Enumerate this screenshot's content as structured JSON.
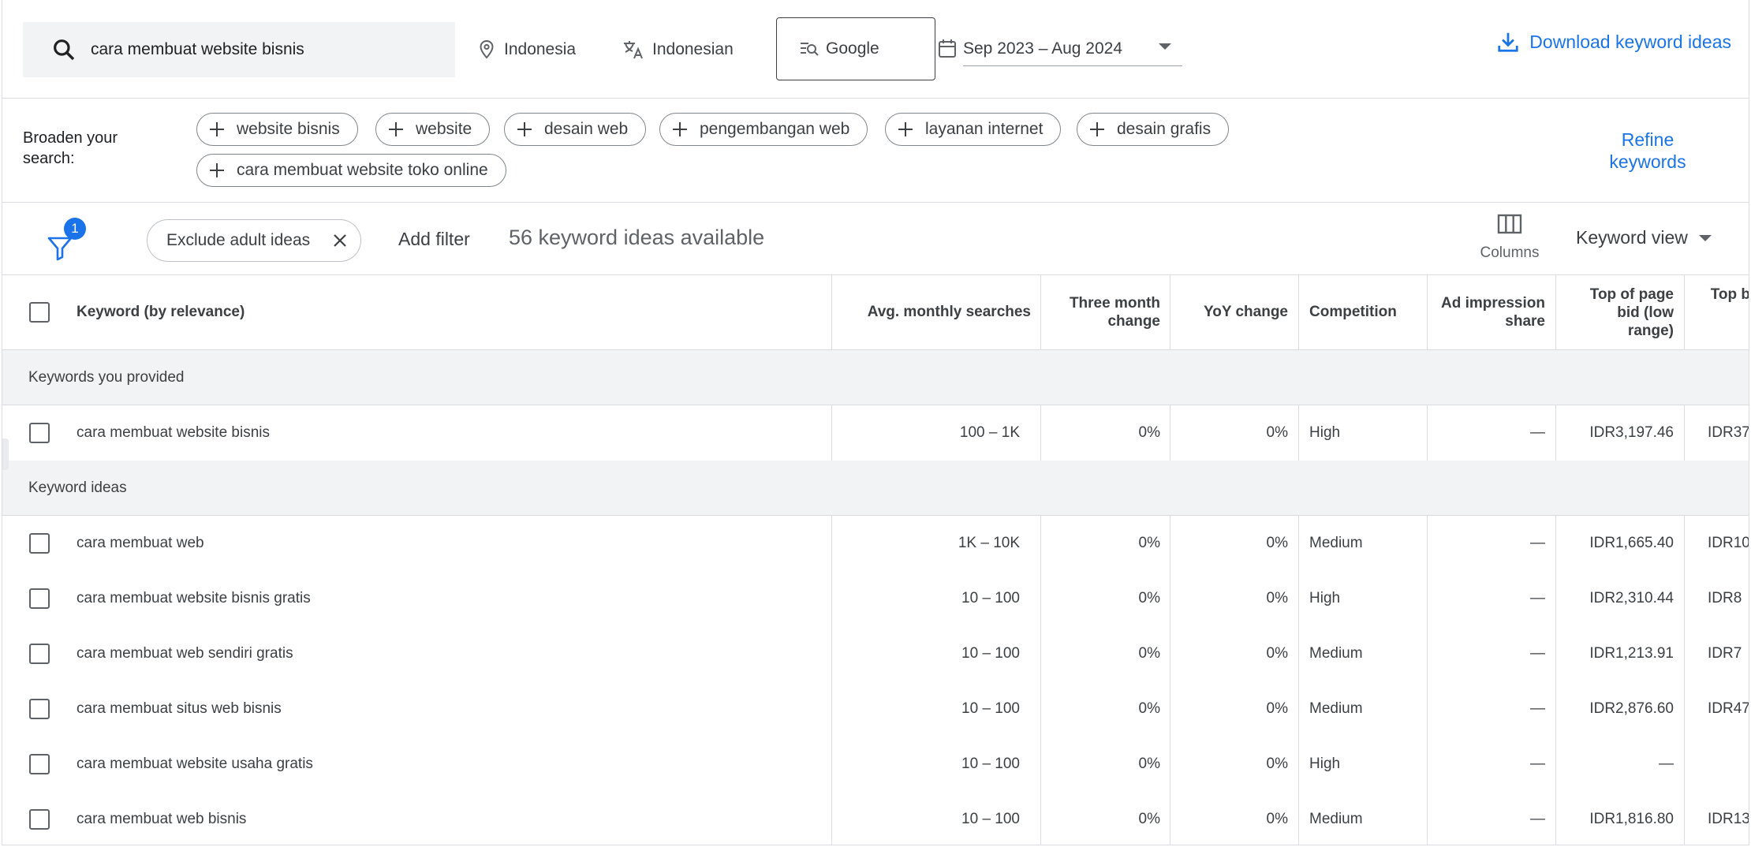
{
  "search": {
    "query": "cara membuat website bisnis"
  },
  "topbar": {
    "location": "Indonesia",
    "language": "Indonesian",
    "engine": "Google",
    "date_range": "Sep 2023 – Aug 2024",
    "download_label": "Download keyword ideas"
  },
  "broaden": {
    "label": "Broaden your search:",
    "chips": [
      "website bisnis",
      "website",
      "desain web",
      "pengembangan web",
      "layanan internet",
      "desain grafis",
      "cara membuat website toko online"
    ],
    "refine_label": "Refine keywords"
  },
  "filters": {
    "badge": "1",
    "chip_label": "Exclude adult ideas",
    "add_filter": "Add filter",
    "count_text": "56 keyword ideas available",
    "columns_label": "Columns",
    "view_label": "Keyword view"
  },
  "table": {
    "headers": {
      "keyword": "Keyword (by relevance)",
      "avg": "Avg. monthly searches",
      "three_month": "Three month change",
      "yoy": "YoY change",
      "competition": "Competition",
      "ad_share": "Ad impression share",
      "bid_low": "Top of page bid (low range)",
      "bid_high": "Top b"
    },
    "groups": {
      "provided": "Keywords you provided",
      "ideas": "Keyword ideas"
    },
    "provided_rows": [
      {
        "keyword": "cara membuat website bisnis",
        "avg": "100 – 1K",
        "three": "0%",
        "yoy": "0%",
        "comp": "High",
        "share": "—",
        "low": "IDR3,197.46",
        "high": "IDR37"
      }
    ],
    "idea_rows": [
      {
        "keyword": "cara membuat web",
        "avg": "1K – 10K",
        "three": "0%",
        "yoy": "0%",
        "comp": "Medium",
        "share": "—",
        "low": "IDR1,665.40",
        "high": "IDR10"
      },
      {
        "keyword": "cara membuat website bisnis gratis",
        "avg": "10 – 100",
        "three": "0%",
        "yoy": "0%",
        "comp": "High",
        "share": "—",
        "low": "IDR2,310.44",
        "high": "IDR8"
      },
      {
        "keyword": "cara membuat web sendiri gratis",
        "avg": "10 – 100",
        "three": "0%",
        "yoy": "0%",
        "comp": "Medium",
        "share": "—",
        "low": "IDR1,213.91",
        "high": "IDR7"
      },
      {
        "keyword": "cara membuat situs web bisnis",
        "avg": "10 – 100",
        "three": "0%",
        "yoy": "0%",
        "comp": "Medium",
        "share": "—",
        "low": "IDR2,876.60",
        "high": "IDR47"
      },
      {
        "keyword": "cara membuat website usaha gratis",
        "avg": "10 – 100",
        "three": "0%",
        "yoy": "0%",
        "comp": "High",
        "share": "—",
        "low": "—",
        "high": ""
      },
      {
        "keyword": "cara membuat web bisnis",
        "avg": "10 – 100",
        "three": "0%",
        "yoy": "0%",
        "comp": "Medium",
        "share": "—",
        "low": "IDR1,816.80",
        "high": "IDR13"
      }
    ]
  }
}
